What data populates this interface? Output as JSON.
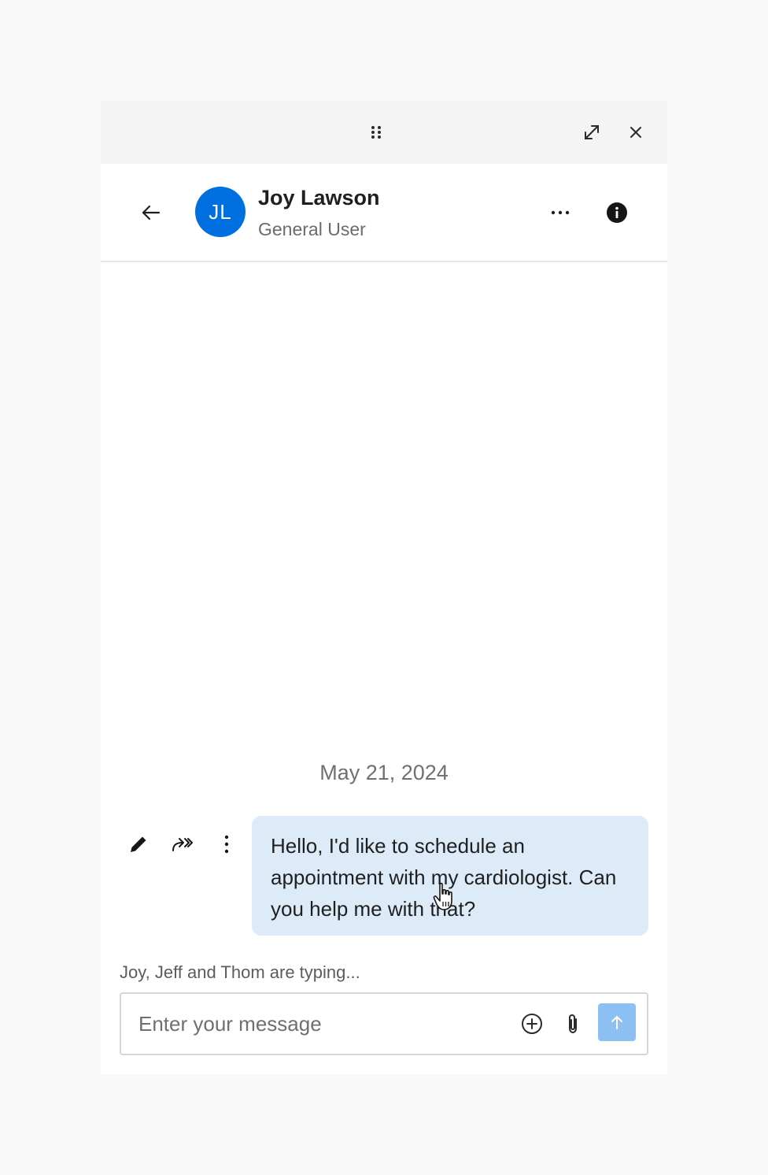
{
  "window": {
    "drag_icon": "drag-handle-icon",
    "expand_icon": "expand-icon",
    "close_icon": "close-icon"
  },
  "header": {
    "back_icon": "arrow-left-icon",
    "avatar_initials": "JL",
    "contact_name": "Joy Lawson",
    "contact_role": "General User",
    "more_icon": "more-horizontal-icon",
    "info_icon": "info-icon"
  },
  "conversation": {
    "date_separator": "May 21, 2024",
    "messages": [
      {
        "text": "Hello, I'd like to schedule an appointment with my cardiologist. Can you help me with that?",
        "actions": [
          "edit-icon",
          "forward-icon",
          "more-vertical-icon"
        ]
      }
    ]
  },
  "typing_indicator": "Joy, Jeff and Thom are typing...",
  "composer": {
    "placeholder": "Enter your message",
    "value": "",
    "add_icon": "add-circle-icon",
    "attach_icon": "paperclip-icon",
    "send_icon": "arrow-up-icon"
  },
  "colors": {
    "avatar": "#0070e0",
    "bubble": "#ddebf9",
    "send_button": "#8cc0f3",
    "window_bar": "#f4f4f4",
    "page_background": "#f9f9f9"
  }
}
